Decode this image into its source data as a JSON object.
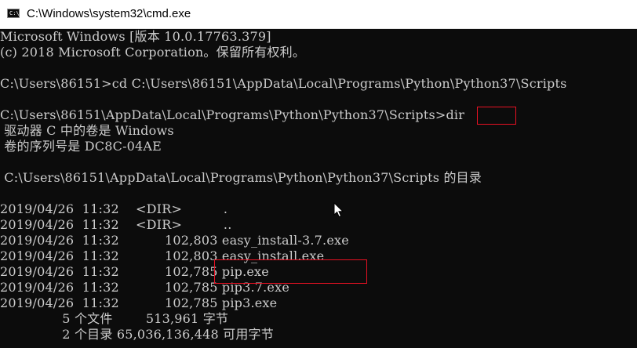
{
  "window": {
    "title": "C:\\Windows\\system32\\cmd.exe"
  },
  "console": {
    "lines": [
      "Microsoft Windows [版本 10.0.17763.379]",
      "(c) 2018 Microsoft Corporation。保留所有权利。",
      "",
      "C:\\Users\\86151>cd C:\\Users\\86151\\AppData\\Local\\Programs\\Python\\Python37\\Scripts",
      "",
      "C:\\Users\\86151\\AppData\\Local\\Programs\\Python\\Python37\\Scripts>dir",
      " 驱动器 C 中的卷是 Windows",
      " 卷的序列号是 DC8C-04AE",
      "",
      " C:\\Users\\86151\\AppData\\Local\\Programs\\Python\\Python37\\Scripts 的目录",
      "",
      "2019/04/26  11:32    <DIR>          .",
      "2019/04/26  11:32    <DIR>          ..",
      "2019/04/26  11:32           102,803 easy_install-3.7.exe",
      "2019/04/26  11:32           102,803 easy_install.exe",
      "2019/04/26  11:32           102,785 pip.exe",
      "2019/04/26  11:32           102,785 pip3.7.exe",
      "2019/04/26  11:32           102,785 pip3.exe",
      "               5 个文件        513,961 字节",
      "               2 个目录 65,036,136,448 可用字节"
    ]
  },
  "colors": {
    "background": "#0c0c0c",
    "text": "#cccccc",
    "highlight": "#e81123"
  }
}
